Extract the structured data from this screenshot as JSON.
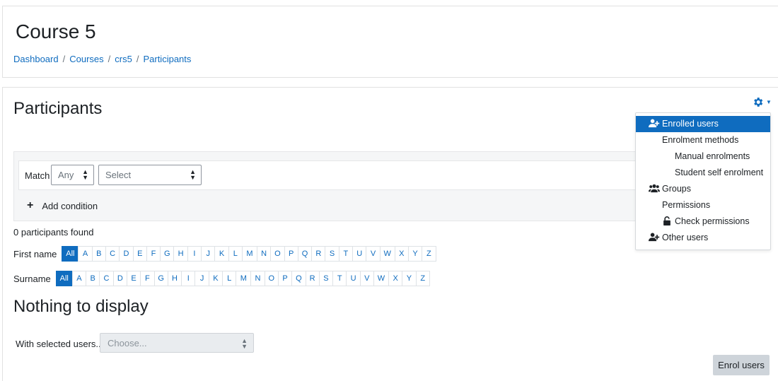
{
  "header": {
    "course_title": "Course 5",
    "breadcrumb": [
      "Dashboard",
      "Courses",
      "crs5",
      "Participants"
    ]
  },
  "main": {
    "heading": "Participants",
    "filter": {
      "match_label": "Match",
      "match_value": "Any",
      "select_value": "Select",
      "add_condition": "Add condition"
    },
    "found_text": "0 participants found",
    "first_name_label": "First name",
    "surname_label": "Surname",
    "all_label": "All",
    "letters": [
      "A",
      "B",
      "C",
      "D",
      "E",
      "F",
      "G",
      "H",
      "I",
      "J",
      "K",
      "L",
      "M",
      "N",
      "O",
      "P",
      "Q",
      "R",
      "S",
      "T",
      "U",
      "V",
      "W",
      "X",
      "Y",
      "Z"
    ],
    "nothing_text": "Nothing to display",
    "with_selected_label": "With selected users...",
    "choose_placeholder": "Choose...",
    "enrol_button": "Enrol users"
  },
  "menu": {
    "items": [
      {
        "label": "Enrolled users",
        "icon": "user-plus-icon"
      },
      {
        "label": "Enrolment methods",
        "icon": ""
      },
      {
        "label": "Manual enrolments",
        "icon": ""
      },
      {
        "label": "Student self enrolment",
        "icon": ""
      },
      {
        "label": "Groups",
        "icon": "users-icon"
      },
      {
        "label": "Permissions",
        "icon": ""
      },
      {
        "label": "Check permissions",
        "icon": "unlock-icon"
      },
      {
        "label": "Other users",
        "icon": "user-plus-icon"
      }
    ]
  },
  "colors": {
    "accent": "#0f6cbf",
    "button_gray": "#ced4da"
  }
}
